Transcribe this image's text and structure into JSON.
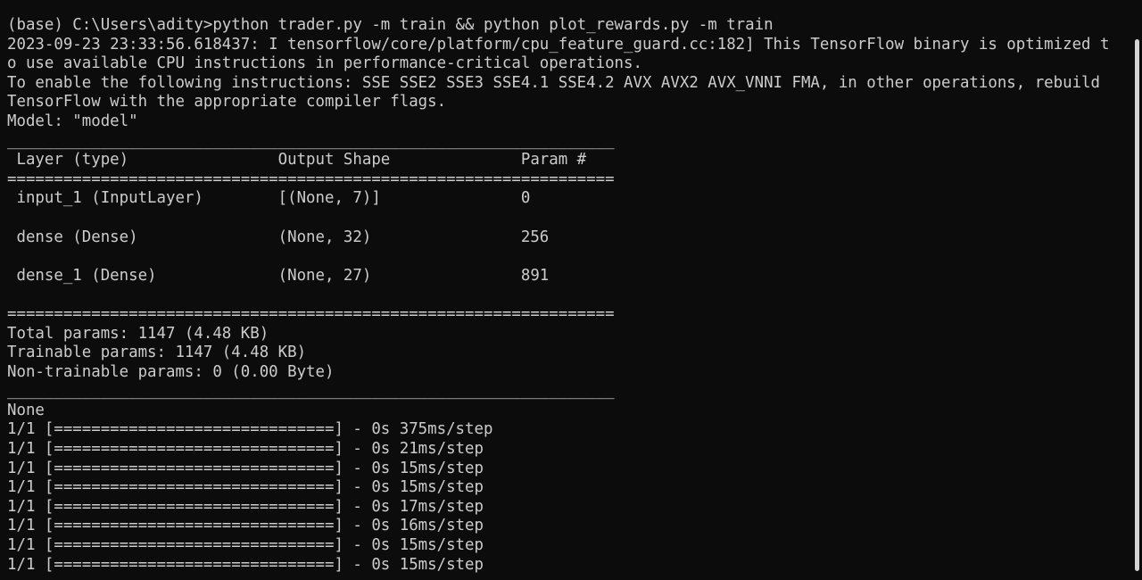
{
  "terminal": {
    "lines": [
      "(base) C:\\Users\\adity>python trader.py -m train && python plot_rewards.py -m train",
      "2023-09-23 23:33:56.618437: I tensorflow/core/platform/cpu_feature_guard.cc:182] This TensorFlow binary is optimized t",
      "o use available CPU instructions in performance-critical operations.",
      "To enable the following instructions: SSE SSE2 SSE3 SSE4.1 SSE4.2 AVX AVX2 AVX_VNNI FMA, in other operations, rebuild",
      "TensorFlow with the appropriate compiler flags.",
      "Model: \"model\"",
      "_________________________________________________________________",
      " Layer (type)                Output Shape              Param #",
      "=================================================================",
      " input_1 (InputLayer)        [(None, 7)]               0",
      "",
      " dense (Dense)               (None, 32)                256",
      "",
      " dense_1 (Dense)             (None, 27)                891",
      "",
      "=================================================================",
      "Total params: 1147 (4.48 KB)",
      "Trainable params: 1147 (4.48 KB)",
      "Non-trainable params: 0 (0.00 Byte)",
      "_________________________________________________________________",
      "None",
      "1/1 [==============================] - 0s 375ms/step",
      "1/1 [==============================] - 0s 21ms/step",
      "1/1 [==============================] - 0s 15ms/step",
      "1/1 [==============================] - 0s 15ms/step",
      "1/1 [==============================] - 0s 17ms/step",
      "1/1 [==============================] - 0s 16ms/step",
      "1/1 [==============================] - 0s 15ms/step",
      "1/1 [==============================] - 0s 15ms/step"
    ]
  }
}
